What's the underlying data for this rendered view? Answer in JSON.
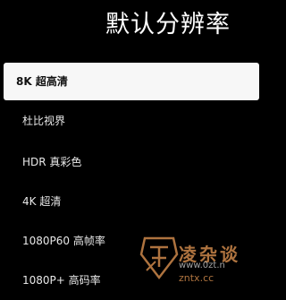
{
  "screen": {
    "title": "默认分辨率"
  },
  "menu": {
    "items": [
      {
        "label": "8K 超高清",
        "selected": true
      },
      {
        "label": "杜比视界",
        "selected": false
      },
      {
        "label": "HDR 真彩色",
        "selected": false
      },
      {
        "label": "4K 超清",
        "selected": false
      },
      {
        "label": "1080P60 高帧率",
        "selected": false
      },
      {
        "label": "1080P+ 高码率",
        "selected": false
      }
    ]
  },
  "watermark": {
    "text": "凌杂谈",
    "url": "www.0zt.n",
    "domain": "zntx.cc"
  },
  "colors": {
    "background": "#000000",
    "selected_bg": "#f7f7f7",
    "text": "#e8e8e8",
    "watermark": "#e89a55"
  }
}
